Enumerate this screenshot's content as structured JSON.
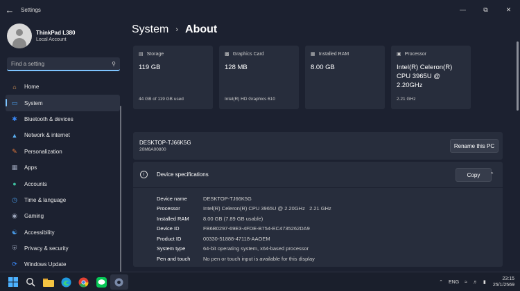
{
  "window": {
    "title": "Settings",
    "back_icon": "back-arrow-icon",
    "controls": [
      "minimize-icon",
      "maximize-icon",
      "close-icon"
    ]
  },
  "profile": {
    "name": "ThinkPad L380",
    "account": "Local Account"
  },
  "search": {
    "placeholder": "Find a setting",
    "value": ""
  },
  "nav": {
    "items": [
      {
        "label": "Home",
        "icon": "home-icon",
        "color": "#e8a05a"
      },
      {
        "label": "System",
        "icon": "system-icon",
        "color": "#4ea8ff"
      },
      {
        "label": "Bluetooth & devices",
        "icon": "bluetooth-icon",
        "color": "#3b8cff"
      },
      {
        "label": "Network & internet",
        "icon": "network-icon",
        "color": "#5aaef0"
      },
      {
        "label": "Personalization",
        "icon": "personalization-icon",
        "color": "#e87a3a"
      },
      {
        "label": "Apps",
        "icon": "apps-icon",
        "color": "#9aa3b8"
      },
      {
        "label": "Accounts",
        "icon": "accounts-icon",
        "color": "#3fbf9f"
      },
      {
        "label": "Time & language",
        "icon": "time-language-icon",
        "color": "#4aa0f0"
      },
      {
        "label": "Gaming",
        "icon": "gaming-icon",
        "color": "#9aa3b8"
      },
      {
        "label": "Accessibility",
        "icon": "accessibility-icon",
        "color": "#4aa0f0"
      },
      {
        "label": "Privacy & security",
        "icon": "shield-icon",
        "color": "#9aa3b8"
      },
      {
        "label": "Windows Update",
        "icon": "update-icon",
        "color": "#3b8cff"
      }
    ],
    "active_index": 1
  },
  "breadcrumb": {
    "parent": "System",
    "separator": "›",
    "current": "About"
  },
  "cards": [
    {
      "title": "Storage",
      "value": "119 GB",
      "sub": "44 GB of 119 GB used",
      "icon": "storage-icon"
    },
    {
      "title": "Graphics Card",
      "value": "128 MB",
      "sub": "Intel(R) HD Graphics 610",
      "icon": "graphics-card-icon"
    },
    {
      "title": "Installed RAM",
      "value": "8.00 GB",
      "sub": "",
      "icon": "ram-icon"
    },
    {
      "title": "Processor",
      "value": "Intel(R) Celeron(R) CPU 3965U @ 2.20GHz",
      "sub": "2.21 GHz",
      "icon": "processor-icon"
    }
  ],
  "device": {
    "name": "DESKTOP-TJ66K5G",
    "model": "20M6A00800",
    "rename_label": "Rename this PC"
  },
  "specs": {
    "title": "Device specifications",
    "copy_label": "Copy",
    "rows": [
      {
        "key": "Device name",
        "value": "DESKTOP-TJ66K5G"
      },
      {
        "key": "Processor",
        "value": "Intel(R) Celeron(R) CPU 3965U @ 2.20GHz   2.21 GHz"
      },
      {
        "key": "Installed RAM",
        "value": "8.00 GB (7.89 GB usable)"
      },
      {
        "key": "Device ID",
        "value": "FB6B0297-69E3-4FDE-B754-EC4735262DA9"
      },
      {
        "key": "Product ID",
        "value": "00330-51888-47118-AAOEM"
      },
      {
        "key": "System type",
        "value": "64-bit operating system, x64-based processor"
      },
      {
        "key": "Pen and touch",
        "value": "No pen or touch input is available for this display"
      }
    ]
  },
  "taskbar": {
    "apps": [
      "start-icon",
      "search-icon",
      "file-explorer-icon",
      "edge-icon",
      "chrome-icon",
      "line-icon",
      "settings-icon"
    ],
    "active_app": "settings-icon",
    "tray": {
      "language": "ENG",
      "time": "23:15",
      "date": "25/1/2569"
    }
  },
  "colors": {
    "accent": "#7ec4ff",
    "background": "#1c2130",
    "card": "#272d3c"
  }
}
